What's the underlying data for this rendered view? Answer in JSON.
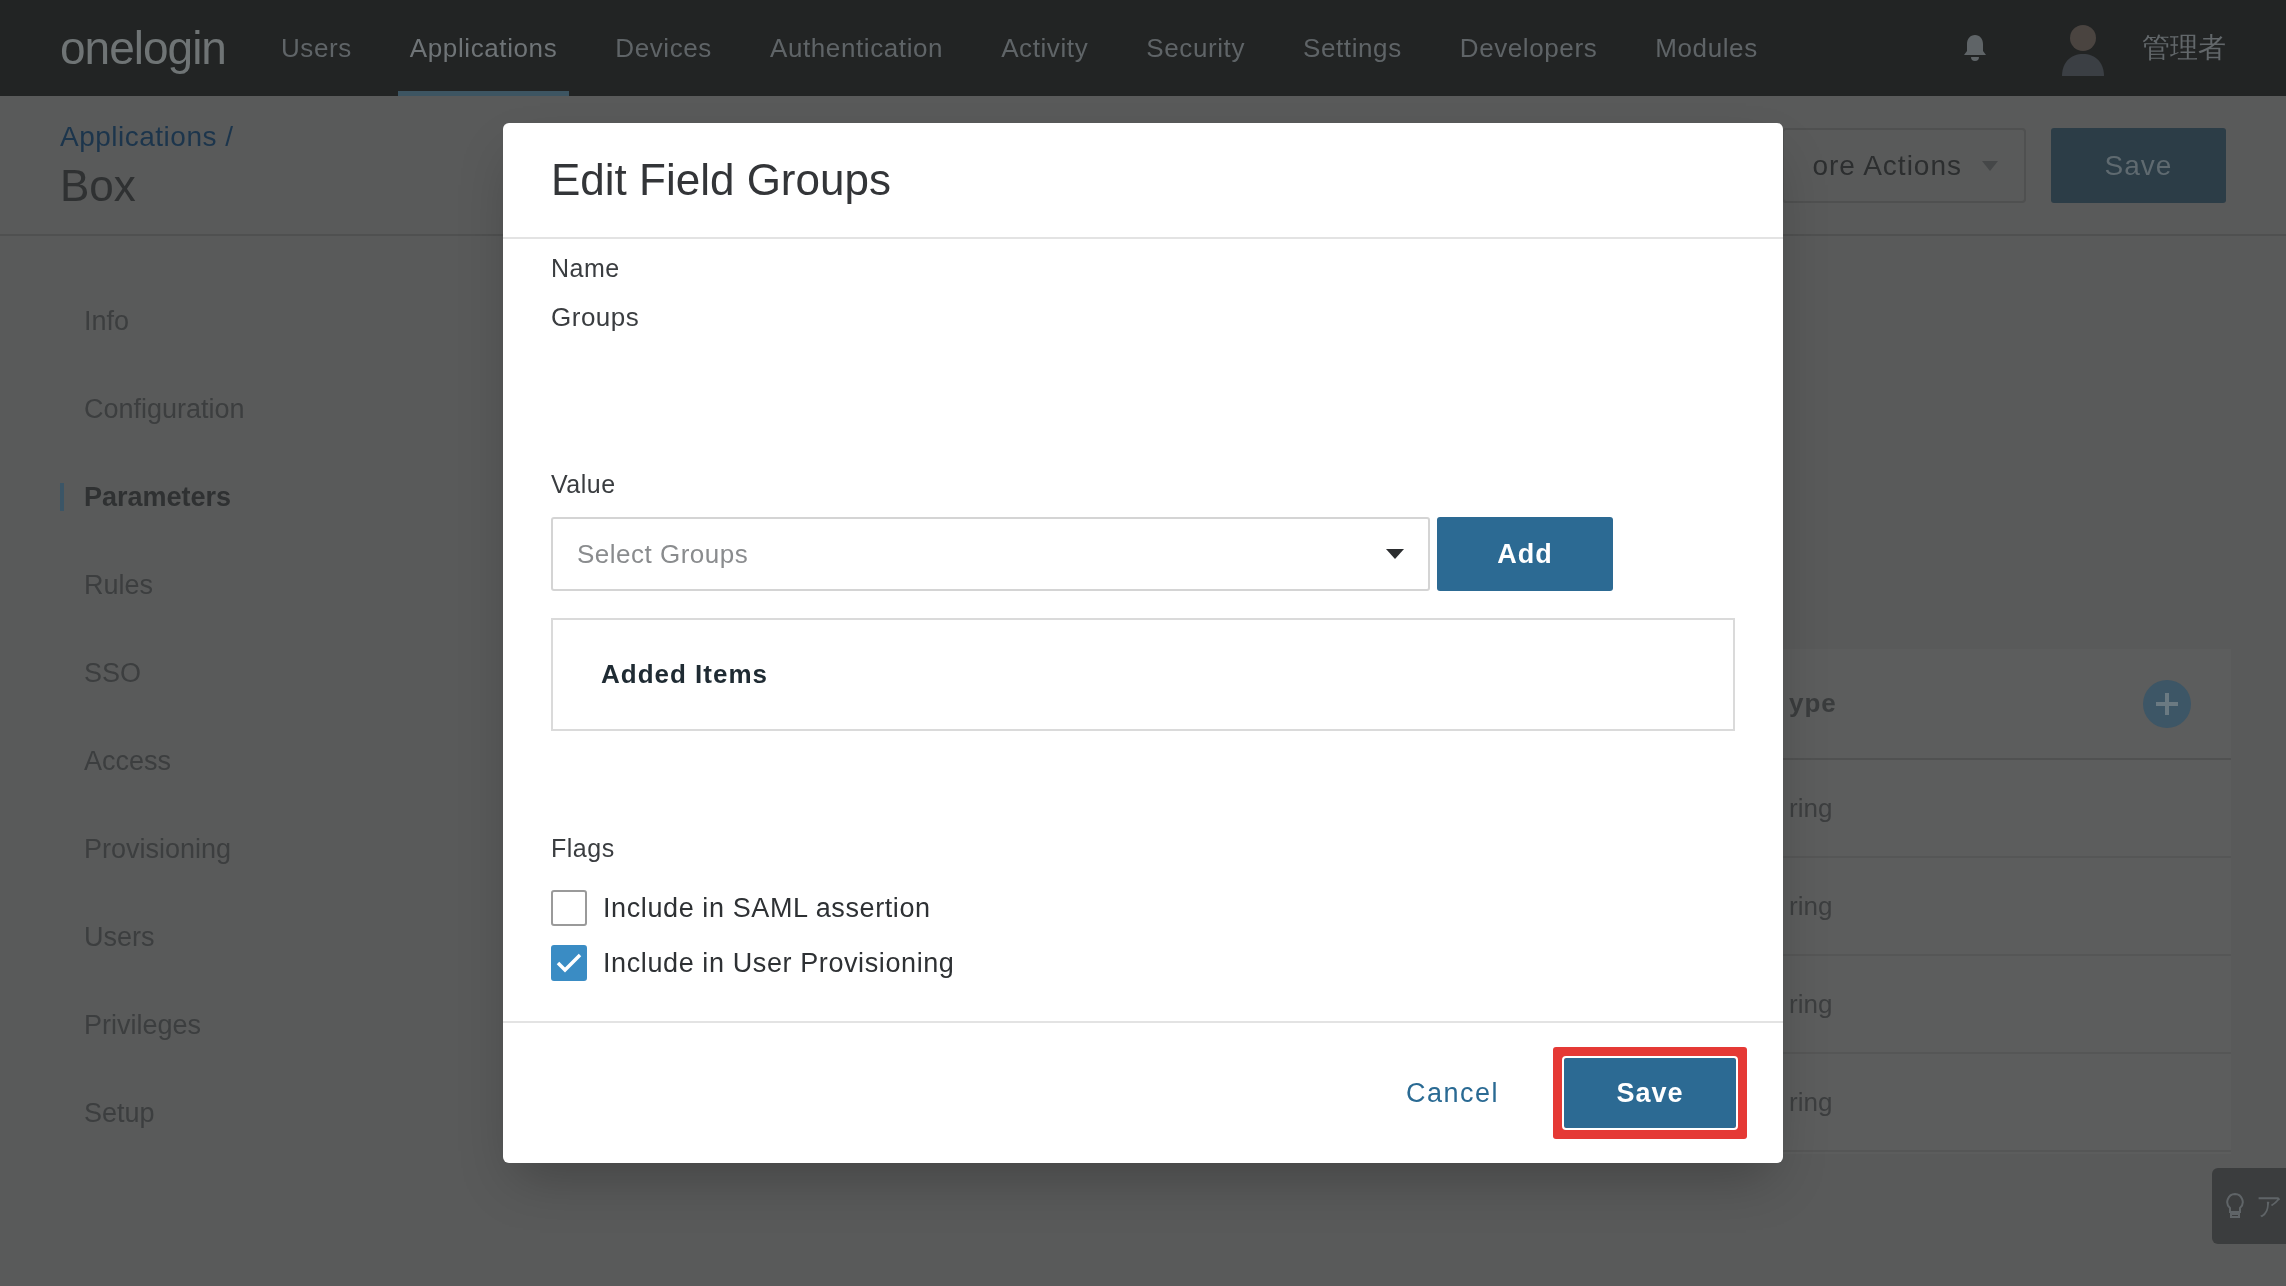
{
  "nav": {
    "logo": "onelogin",
    "items": [
      {
        "label": "Users",
        "selected": false
      },
      {
        "label": "Applications",
        "selected": true
      },
      {
        "label": "Devices",
        "selected": false
      },
      {
        "label": "Authentication",
        "selected": false
      },
      {
        "label": "Activity",
        "selected": false
      },
      {
        "label": "Security",
        "selected": false
      },
      {
        "label": "Settings",
        "selected": false
      },
      {
        "label": "Developers",
        "selected": false
      },
      {
        "label": "Modules",
        "selected": false
      }
    ],
    "user": "管理者"
  },
  "breadcrumb": {
    "parent": "Applications /",
    "title": "Box"
  },
  "header_actions": {
    "more": "ore Actions",
    "save": "Save"
  },
  "sidebar": {
    "items": [
      {
        "label": "Info",
        "selected": false
      },
      {
        "label": "Configuration",
        "selected": false
      },
      {
        "label": "Parameters",
        "selected": true
      },
      {
        "label": "Rules",
        "selected": false
      },
      {
        "label": "SSO",
        "selected": false
      },
      {
        "label": "Access",
        "selected": false
      },
      {
        "label": "Provisioning",
        "selected": false
      },
      {
        "label": "Users",
        "selected": false
      },
      {
        "label": "Privileges",
        "selected": false
      },
      {
        "label": "Setup",
        "selected": false
      }
    ]
  },
  "table": {
    "header": "ype",
    "rows": [
      "ring",
      "ring",
      "ring",
      "ring"
    ]
  },
  "help_widget": {
    "label": "ア"
  },
  "dialog": {
    "title": "Edit Field Groups",
    "name_label": "Name",
    "name_value": "Groups",
    "value_label": "Value",
    "select": {
      "placeholder": "Select Groups"
    },
    "add_button": "Add",
    "added_items_title": "Added Items",
    "flags_label": "Flags",
    "flags": [
      {
        "label": "Include in SAML assertion",
        "checked": false
      },
      {
        "label": "Include in User Provisioning",
        "checked": true
      }
    ],
    "cancel": "Cancel",
    "save": {
      "label": "Save",
      "highlighted": true
    }
  }
}
